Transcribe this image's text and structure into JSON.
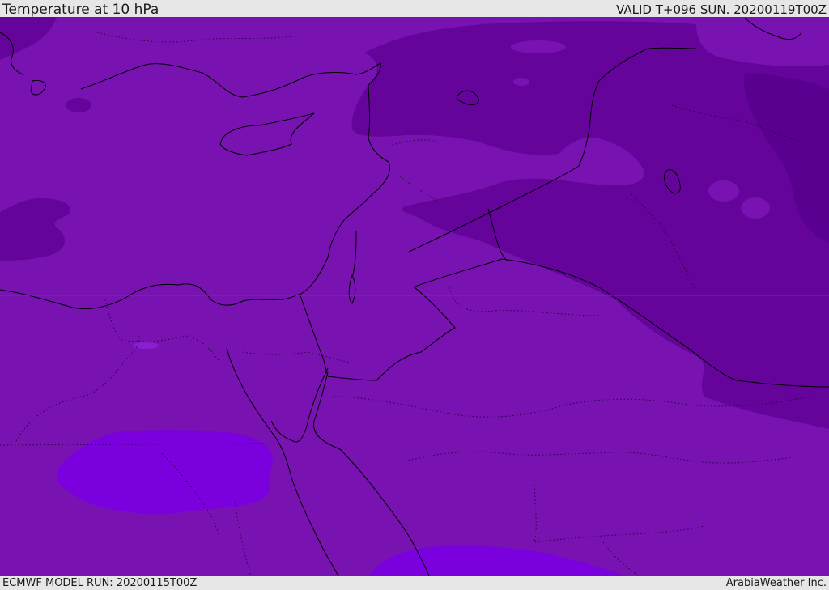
{
  "header": {
    "title": "Temperature at 10 hPa",
    "valid": "VALID T+096 SUN. 20200119T00Z"
  },
  "footer": {
    "model_run": "ECMWF MODEL RUN: 20200115T00Z",
    "credit": "ArabiaWeather Inc."
  },
  "map": {
    "fill_colors": {
      "base": "#7813b1",
      "dark": "#65049b",
      "darker": "#5a0090",
      "light": "#8a1fcf",
      "bright": "#7b00de",
      "coastline": "#000000",
      "border_dotted": "#2a0044"
    }
  }
}
